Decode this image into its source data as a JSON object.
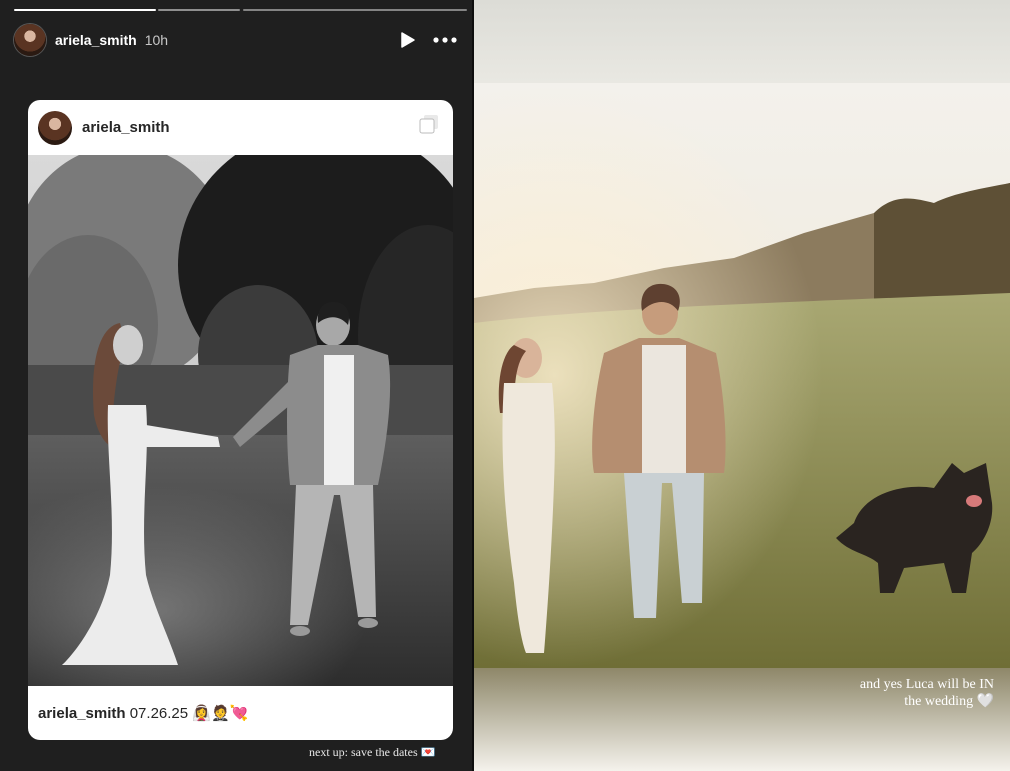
{
  "left_story": {
    "username": "ariela_smith",
    "time_ago": "10h",
    "play_icon": "play-icon",
    "more_icon": "more-dots-icon",
    "progress_segments": [
      {
        "state": "complete"
      },
      {
        "state": "complete"
      },
      {
        "state": "upcoming"
      }
    ],
    "post": {
      "username": "ariela_smith",
      "caption_user": "ariela_smith",
      "caption_text": "07.26.25 👰‍♀️🤵💘",
      "multi_photo_icon": "carousel-icon"
    },
    "footer_text": "next up: save the dates 💌"
  },
  "right_story": {
    "caption_line1": "and yes Luca will be IN",
    "caption_line2": "the wedding 🤍"
  },
  "colors": {
    "background": "#1f1f1f",
    "card": "#ffffff",
    "text_dark": "#262626",
    "field_green": "#8f8a4a",
    "sky": "#f1eee6"
  }
}
